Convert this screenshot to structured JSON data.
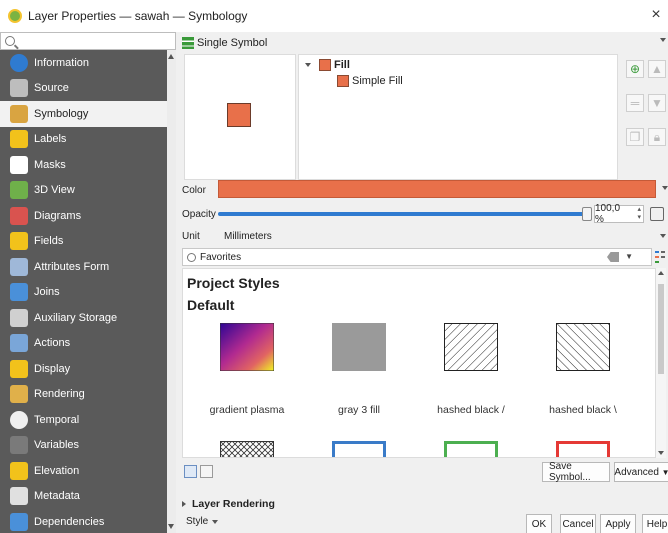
{
  "window": {
    "title": "Layer Properties — sawah — Symbology",
    "close_glyph": "×"
  },
  "sidebar": {
    "search_placeholder": "",
    "items": [
      {
        "label": "Information",
        "icon": "info-icon",
        "color": "#2f7bd0"
      },
      {
        "label": "Source",
        "icon": "source-icon",
        "color": "#bdbdbd"
      },
      {
        "label": "Symbology",
        "icon": "symbology-brush-icon",
        "color": "#d9a441",
        "active": true
      },
      {
        "label": "Labels",
        "icon": "labels-abc-icon",
        "color": "#f2c21b"
      },
      {
        "label": "Masks",
        "icon": "masks-abc-icon",
        "color": "#ffffff"
      },
      {
        "label": "3D View",
        "icon": "3d-cube-icon",
        "color": "#6fb04a"
      },
      {
        "label": "Diagrams",
        "icon": "diagrams-icon",
        "color": "#d9534f"
      },
      {
        "label": "Fields",
        "icon": "fields-icon",
        "color": "#f2c21b"
      },
      {
        "label": "Attributes Form",
        "icon": "attributes-form-icon",
        "color": "#9fb8d8"
      },
      {
        "label": "Joins",
        "icon": "joins-icon",
        "color": "#4a90d9"
      },
      {
        "label": "Auxiliary Storage",
        "icon": "auxiliary-storage-icon",
        "color": "#d0d0d0"
      },
      {
        "label": "Actions",
        "icon": "actions-gear-icon",
        "color": "#7aa6d8"
      },
      {
        "label": "Display",
        "icon": "display-speech-icon",
        "color": "#f2c21b"
      },
      {
        "label": "Rendering",
        "icon": "rendering-brush-icon",
        "color": "#e0b04a"
      },
      {
        "label": "Temporal",
        "icon": "temporal-clock-icon",
        "color": "#f0f0f0"
      },
      {
        "label": "Variables",
        "icon": "variables-icon",
        "color": "#7a7a7a"
      },
      {
        "label": "Elevation",
        "icon": "elevation-icon",
        "color": "#f2c21b"
      },
      {
        "label": "Metadata",
        "icon": "metadata-icon",
        "color": "#e0e0e0"
      },
      {
        "label": "Dependencies",
        "icon": "dependencies-icon",
        "color": "#4a90d9"
      }
    ]
  },
  "renderer": {
    "selected": "Single Symbol"
  },
  "symbol_tree": {
    "root": "Fill",
    "child": "Simple Fill",
    "fill_color": "#e8704a"
  },
  "properties": {
    "color_label": "Color",
    "color_value": "#e8704a",
    "opacity_label": "Opacity",
    "opacity_value": "100,0 %",
    "opacity_level": 1.0,
    "unit_label": "Unit",
    "unit_value": "Millimeters"
  },
  "library": {
    "search_value": "Favorites",
    "group_project": "Project Styles",
    "group_default": "Default",
    "symbols": [
      {
        "name": "gradient  plasma",
        "kind": "gradient"
      },
      {
        "name": "gray 3 fill",
        "kind": "gray"
      },
      {
        "name": "hashed black /",
        "kind": "hatch-forward"
      },
      {
        "name": "hashed black \\",
        "kind": "hatch-back"
      }
    ],
    "second_row": [
      {
        "kind": "crosshatch",
        "color": "#333333"
      },
      {
        "kind": "outline",
        "color": "#3a7bc8"
      },
      {
        "kind": "outline",
        "color": "#4caf50"
      },
      {
        "kind": "outline",
        "color": "#e53935"
      }
    ]
  },
  "buttons": {
    "save_symbol": "Save Symbol...",
    "advanced": "Advanced",
    "layer_rendering": "Layer Rendering",
    "style": "Style",
    "ok": "OK",
    "cancel": "Cancel",
    "apply": "Apply",
    "help": "Help"
  }
}
